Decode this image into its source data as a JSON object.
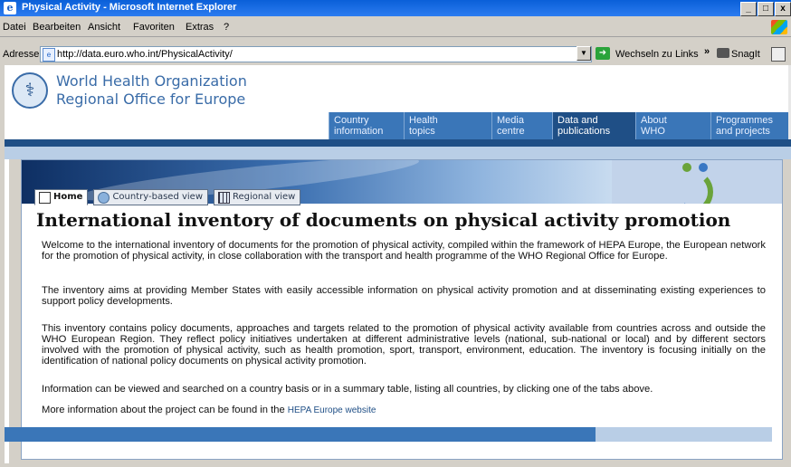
{
  "window": {
    "title": "Physical Activity - Microsoft Internet Explorer"
  },
  "menu": [
    "Datei",
    "Bearbeiten",
    "Ansicht",
    "Favoriten",
    "Extras",
    "?"
  ],
  "address": {
    "label": "Adresse",
    "url": "http://data.euro.who.int/PhysicalActivity/",
    "go_label": "Wechseln zu",
    "links_label": "Links",
    "more": "»",
    "snagit_label": "SnagIt"
  },
  "header": {
    "org_line1": "World Health Organization",
    "org_line2": "Regional Office for Europe"
  },
  "nav": [
    {
      "line1": "Country",
      "line2": "information"
    },
    {
      "line1": "Health",
      "line2": "topics"
    },
    {
      "line1": "Media",
      "line2": "centre"
    },
    {
      "line1": "Data and",
      "line2": "publications"
    },
    {
      "line1": "About",
      "line2": "WHO"
    },
    {
      "line1": "Programmes",
      "line2": "and projects"
    }
  ],
  "tabs": [
    {
      "label": "Home",
      "icon": "house-icon"
    },
    {
      "label": "Country-based view",
      "icon": "globe-icon"
    },
    {
      "label": "Regional view",
      "icon": "table-icon"
    }
  ],
  "page": {
    "title": "International inventory of documents on physical activity promotion",
    "p1": "Welcome to the international inventory of documents for the promotion of physical activity, compiled within the framework of HEPA Europe, the European network for the promotion of physical activity, in close collaboration with the transport and health programme of the WHO Regional Office for Europe.",
    "p2": "The inventory aims at providing Member States with easily accessible information on physical activity promotion and at disseminating existing experiences to support policy developments.",
    "p3": "This inventory contains policy documents, approaches and targets related to the promotion of physical activity available from countries across and outside the WHO European Region. They reflect policy initiatives undertaken at different administrative levels (national, sub-national or local) and by different sectors involved with the promotion of physical activity, such as health promotion, sport, transport, environment, education. The inventory is focusing initially on the identification of national policy documents on physical activity promotion.",
    "p4": "Information can be viewed and searched on a country basis or in a summary table, listing all countries, by clicking one of the tabs above.",
    "p5_prefix": "More information about the project can be found in the",
    "p5_link": "HEPA Europe website"
  }
}
